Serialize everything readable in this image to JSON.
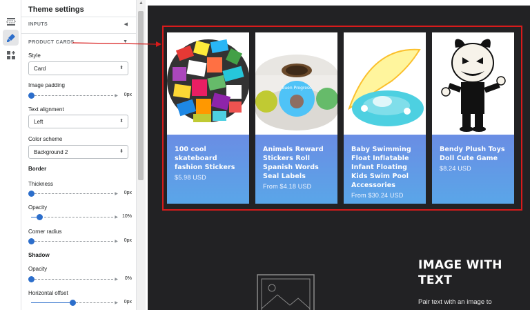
{
  "colors": {
    "highlight": "#d81b1b",
    "accent": "#2c6ecb",
    "card_gradient_top": "#6a8de4",
    "card_gradient_bottom": "#5aa6e8",
    "canvas_bg": "#222224"
  },
  "rail": [
    {
      "icon": "sections-icon"
    },
    {
      "icon": "paint-brush-icon",
      "active": true
    },
    {
      "icon": "apps-icon"
    }
  ],
  "panel": {
    "title": "Theme settings",
    "inputs_label": "INPUTS",
    "product_cards_label": "PRODUCT CARDS",
    "style": {
      "label": "Style",
      "value": "Card"
    },
    "image_padding": {
      "label": "Image padding",
      "value": "0px",
      "level": 0
    },
    "text_alignment": {
      "label": "Text alignment",
      "value": "Left"
    },
    "color_scheme": {
      "label": "Color scheme",
      "value": "Background 2"
    },
    "border": {
      "heading": "Border",
      "thickness": {
        "label": "Thickness",
        "value": "0px",
        "level": 0
      },
      "opacity": {
        "label": "Opacity",
        "value": "10%",
        "level": 0.1
      },
      "corner_radius": {
        "label": "Corner radius",
        "value": "0px",
        "level": 0
      }
    },
    "shadow": {
      "heading": "Shadow",
      "opacity": {
        "label": "Opacity",
        "value": "0%",
        "level": 0
      },
      "horizontal_offset": {
        "label": "Horizontal offset",
        "value": "0px",
        "level": 0.5
      }
    }
  },
  "products": [
    {
      "title": "100 cool skateboard fashion Stickers",
      "price": "$5.98 USD",
      "image": "sticker-pile"
    },
    {
      "title": "Animals Reward Stickers Roll Spanish Words Seal Labels",
      "price": "From $4.18 USD",
      "image": "sticker-roll",
      "roll_text": "Buen Progreso"
    },
    {
      "title": "Baby Swimming Float Inflatable Infant Floating Kids Swim Pool Accessories",
      "price": "From $30.24 USD",
      "image": "swim-float"
    },
    {
      "title": "Bendy Plush Toys Doll Cute Game",
      "price": "$8.24 USD",
      "image": "plush-doll"
    }
  ],
  "image_with_text": {
    "title": "IMAGE WITH TEXT",
    "text": "Pair text with an image to"
  }
}
